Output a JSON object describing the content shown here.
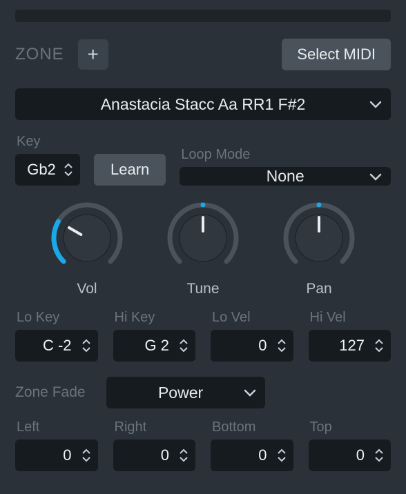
{
  "header": {
    "title": "ZONE",
    "add_label": "+",
    "select_midi_label": "Select MIDI"
  },
  "sample": {
    "name": "Anastacia Stacc Aa RR1 F#2"
  },
  "key": {
    "label": "Key",
    "value": "Gb2",
    "learn_label": "Learn"
  },
  "loop_mode": {
    "label": "Loop Mode",
    "value": "None"
  },
  "knobs": {
    "vol": {
      "label": "Vol",
      "angle": -60
    },
    "tune": {
      "label": "Tune",
      "angle": 0
    },
    "pan": {
      "label": "Pan",
      "angle": 0
    }
  },
  "range": {
    "lo_key": {
      "label": "Lo Key",
      "value": "C -2"
    },
    "hi_key": {
      "label": "Hi Key",
      "value": "G 2"
    },
    "lo_vel": {
      "label": "Lo Vel",
      "value": "0"
    },
    "hi_vel": {
      "label": "Hi Vel",
      "value": "127"
    }
  },
  "zone_fade": {
    "label": "Zone Fade",
    "value": "Power"
  },
  "fade": {
    "left": {
      "label": "Left",
      "value": "0"
    },
    "right": {
      "label": "Right",
      "value": "0"
    },
    "bottom": {
      "label": "Bottom",
      "value": "0"
    },
    "top": {
      "label": "Top",
      "value": "0"
    }
  },
  "colors": {
    "accent": "#1aa8e8"
  }
}
